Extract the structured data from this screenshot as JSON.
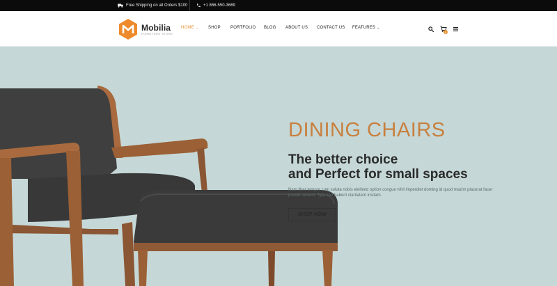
{
  "topbar": {
    "shipping_text": "Free Shipping on all Orders $100",
    "phone_text": "+1 866-550-3669"
  },
  "brand": {
    "name": "Mobilia",
    "tagline": "FURNITURE STORE",
    "accent_color": "#e8932f"
  },
  "nav": {
    "items": [
      {
        "label": "HOME",
        "active": true,
        "has_dropdown": true
      },
      {
        "label": "SHOP",
        "active": false,
        "has_dropdown": false
      },
      {
        "label": "PORTFOLIO",
        "active": false,
        "has_dropdown": false
      },
      {
        "label": "BLOG",
        "active": false,
        "has_dropdown": false
      },
      {
        "label": "ABOUT US",
        "active": false,
        "has_dropdown": false
      },
      {
        "label": "CONTACT US",
        "active": false,
        "has_dropdown": false
      },
      {
        "label": "FEATURES",
        "active": false,
        "has_dropdown": true
      }
    ],
    "dropdown_glyph": "⌄"
  },
  "header_icons": {
    "search": "search-icon",
    "cart": "cart-icon",
    "cart_count": "0",
    "menu": "menu-icon"
  },
  "hero": {
    "title": "DINING CHAIRS",
    "subtitle_line1": "The better choice",
    "subtitle_line2": "and Perfect for small spaces",
    "body_line1": "Nam liber tempor cum soluta nobis eleifend option congue nihil imperdiet doming id quod mazim placerat facer",
    "body_line2": "possim assum. Typi non habent claritatem insitam.",
    "button_label": "SHOP NOW",
    "background_color": "#c5d8d7",
    "title_color": "#c8803f"
  }
}
